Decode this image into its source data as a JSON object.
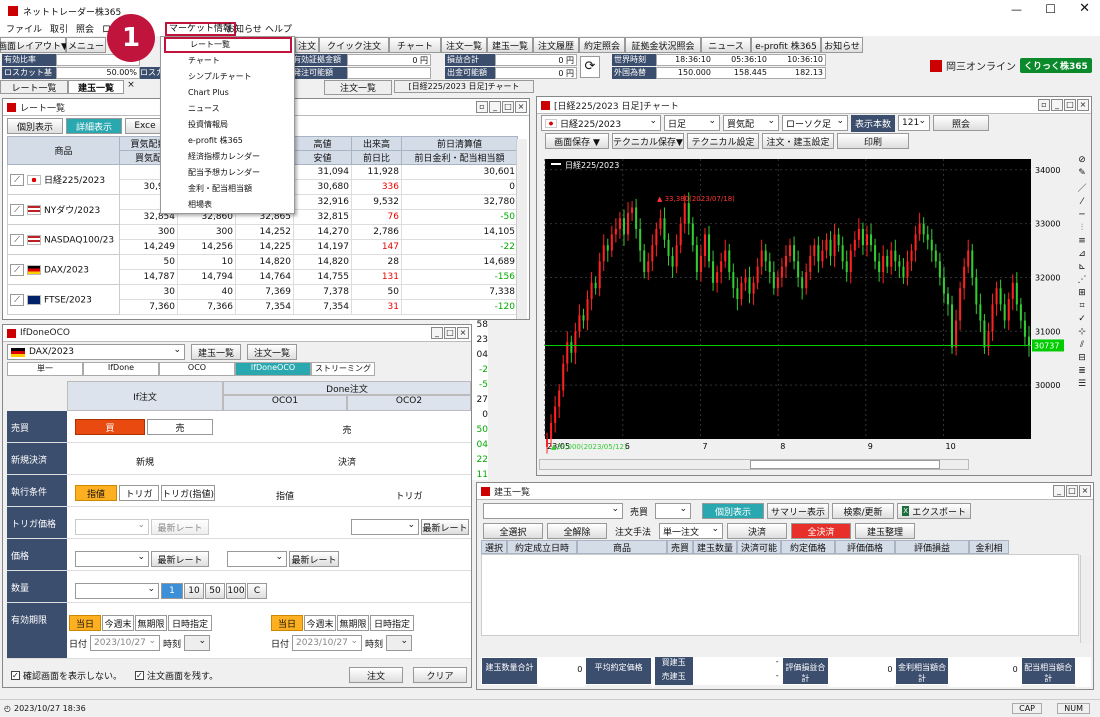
{
  "app": {
    "title": "ネットトレーダー株365"
  },
  "menubar": [
    "ファイル",
    "取引",
    "照会",
    "ロ"
  ],
  "menu_open": {
    "label": "マーケット情報",
    "other": [
      "お知らせ",
      "ヘルプ"
    ]
  },
  "dropdown": [
    "レート一覧",
    "チャート",
    "シンプルチャート",
    "Chart Plus",
    "ニュース",
    "投資情報局",
    "e-profit 株365",
    "経済指標カレンダー",
    "配当予想カレンダー",
    "金利・配当相当額",
    "相場表"
  ],
  "callout": "1",
  "toolbar1": [
    "画面レイアウト▼",
    "メニュー"
  ],
  "toolbar2": [
    "注文",
    "クイック注文",
    "チャート",
    "注文一覧",
    "建玉一覧",
    "注文履歴",
    "約定照会",
    "証拠金状況照会",
    "ニュース",
    "e-profit 株365",
    "お知らせ"
  ],
  "status_left": [
    [
      "有効比率",
      ""
    ],
    [
      "ロスカット基準",
      "50.00%"
    ]
  ],
  "status_left_labels": [
    "ロスカ"
  ],
  "status_mid": [
    [
      "有効証拠金額",
      "0 円"
    ],
    [
      "発注可能額",
      ""
    ]
  ],
  "status_mid2": [
    [
      "損益合計",
      "0 円"
    ],
    [
      "出金可能額",
      "0 円"
    ]
  ],
  "times": {
    "world": "世界時刻",
    "fx": "外国為替",
    "t1": "18:36:10",
    "t2": "05:36:10",
    "t3": "10:36:10",
    "r1": "150.000",
    "r2": "158.445",
    "r3": "182.13"
  },
  "brand": {
    "name": "岡三オンライン",
    "badge": "くりっく株365"
  },
  "tabs": [
    "レート一覧",
    "建玉一覧",
    "×",
    "注文一覧",
    "[日経225/2023 日足]チャート"
  ],
  "rate_window": {
    "title": "レート一覧",
    "btn1": "個別表示",
    "btn2": "詳細表示",
    "btn3": "Exce",
    "headers": [
      "商品",
      "買気配数",
      "",
      "高値",
      "出来高",
      "前日清算値"
    ],
    "subheaders": [
      "買気配",
      "",
      "",
      "安値",
      "前日比",
      "前日金利・配当相当額"
    ],
    "rows": [
      {
        "name": "日経225/2023",
        "flag": "jp",
        "a1": "",
        "a2": "",
        "a3": "",
        "hi": "31,094",
        "vol": "11,928",
        "prev": "30,601",
        "b1": "30,930",
        "b2": "",
        "b3": "",
        "lo": "30,680",
        "chg": "336",
        "cv": "red",
        "acc": "0"
      },
      {
        "name": "NYダウ/2023",
        "flag": "us",
        "a1": "3",
        "a2": "",
        "a3": "",
        "hi": "32,916",
        "vol": "9,532",
        "prev": "32,780",
        "b1": "32,854",
        "b2": "32,860",
        "b3": "32,865",
        "lo": "32,815",
        "chg": "76",
        "cv": "red",
        "acc": "-50"
      },
      {
        "name": "NASDAQ100/23",
        "flag": "us",
        "a1": "300",
        "a2": "300",
        "a3": "14,252",
        "hi": "14,270",
        "vol": "2,786",
        "prev": "14,105",
        "b1": "14,249",
        "b2": "14,256",
        "b3": "14,225",
        "lo": "14,197",
        "chg": "147",
        "cv": "red",
        "acc": "-22"
      },
      {
        "name": "DAX/2023",
        "flag": "de",
        "a1": "50",
        "a2": "10",
        "a3": "14,820",
        "hi": "14,820",
        "vol": "28",
        "prev": "14,689",
        "b1": "14,787",
        "b2": "14,794",
        "b3": "14,764",
        "lo": "14,755",
        "chg": "131",
        "cv": "red",
        "acc": "-156"
      },
      {
        "name": "FTSE/2023",
        "flag": "uk",
        "a1": "30",
        "a2": "40",
        "a3": "7,369",
        "hi": "7,378",
        "vol": "50",
        "prev": "7,338",
        "b1": "7,360",
        "b2": "7,366",
        "b3": "7,354",
        "lo": "7,354",
        "chg": "31",
        "cv": "red",
        "acc": "-120"
      }
    ],
    "extra": [
      "58",
      "23",
      "04",
      "-2",
      "-5",
      "27",
      "0",
      "50",
      "04",
      "22",
      "11"
    ]
  },
  "ifdone": {
    "title": "IfDoneOCO",
    "product": "DAX/2023",
    "btn1": "建玉一覧",
    "btn2": "注文一覧",
    "tabs": [
      "単一",
      "IfDone",
      "OCO",
      "IfDoneOCO",
      "ストリーミング"
    ],
    "head_if": "If注文",
    "head_done": "Done注文",
    "oco1": "OCO1",
    "oco2": "OCO2",
    "row_labels": [
      "売買",
      "新規決済",
      "執行条件",
      "トリガ価格",
      "価格",
      "数量",
      "有効期限"
    ],
    "buy": "買",
    "sell": "売",
    "sell2": "売",
    "new": "新規",
    "close": "決済",
    "cond": [
      "指値",
      "トリガ",
      "トリガ(指値)"
    ],
    "cond2": "指値",
    "cond3": "トリガ",
    "latest": "最新レート",
    "qty_btns": [
      "1",
      "10",
      "50",
      "100",
      "C"
    ],
    "exp": [
      "当日",
      "今週末",
      "無期限",
      "日時指定"
    ],
    "date_label": "日付",
    "date": "2023/10/27",
    "time_label": "時刻",
    "chk1": "確認画面を表示しない。",
    "chk2": "注文画面を残す。",
    "order": "注文",
    "clear": "クリア"
  },
  "chart_window": {
    "title": "[日経225/2023 日足]チャート",
    "product": "日経225/2023",
    "period": "日足",
    "price": "買気配",
    "style": "ローソク足",
    "count_label": "表示本数",
    "count": "121",
    "query": "照会",
    "btns": [
      "画面保存 ▼",
      "テクニカル保存▼",
      "テクニカル設定",
      "注文・建玉設定",
      "印刷"
    ],
    "legend": "日経225/2023",
    "high_note": "▲ 33,380(2023/07/18)",
    "low_note": "▲29,000(2023/05/12)",
    "last": "30737",
    "yticks": [
      "34000",
      "33000",
      "32000",
      "31000",
      "30000"
    ],
    "xticks": [
      "23/05",
      "6",
      "7",
      "8",
      "9",
      "10"
    ]
  },
  "positions": {
    "title": "建玉一覧",
    "side": "売買",
    "btns": [
      "個別表示",
      "サマリー表示",
      "検索/更新",
      "エクスポート"
    ],
    "btns2": [
      "全選択",
      "全解除"
    ],
    "method": "注文手法",
    "method_val": "単一注文",
    "settle": "決済",
    "allsettle": "全決済",
    "organize": "建玉整理",
    "cols": [
      "選択",
      "約定成立日時",
      "商品",
      "売買",
      "建玉数量",
      "決済可能",
      "約定価格",
      "評価価格",
      "評価損益",
      "金利相"
    ],
    "foot": [
      [
        "建玉数量合計",
        "0"
      ],
      [
        "平均約定価格",
        ""
      ],
      [
        "買建玉",
        "-"
      ],
      [
        "売建玉",
        "-"
      ],
      [
        "評価損益合計",
        "0"
      ],
      [
        "金利相当額合計",
        "0"
      ],
      [
        "配当相当額合計",
        ""
      ]
    ]
  },
  "statusbar": {
    "left": "2023/10/27 18:36",
    "cap": "CAP",
    "num": "NUM"
  },
  "chart_data": {
    "type": "candlestick",
    "title": "日経225/2023",
    "yrange": [
      29000,
      34200
    ],
    "x": [
      "23/05",
      "6",
      "7",
      "8",
      "9",
      "10"
    ],
    "values": [
      29000,
      29300,
      29600,
      29900,
      30400,
      30800,
      30600,
      31000,
      31300,
      31200,
      31600,
      31900,
      31800,
      32300,
      32600,
      32500,
      32800,
      32900,
      33100,
      32800,
      33200,
      33300,
      32900,
      32500,
      32100,
      32300,
      32600,
      32900,
      33100,
      32700,
      32400,
      32200,
      32600,
      33000,
      33380,
      33000,
      32600,
      32100,
      32400,
      32800,
      32300,
      31900,
      32100,
      32300,
      32500,
      32100,
      31800,
      31600,
      31900,
      32000,
      31700,
      31900,
      32200,
      32500,
      32300,
      32100,
      31800,
      32000,
      32200,
      32400,
      32600,
      32300,
      32000,
      31800,
      32100,
      32400,
      32600,
      32300,
      32500,
      32700,
      32400,
      32800,
      32600,
      32300,
      32100,
      32500,
      32700,
      32900,
      32600,
      32800,
      32600,
      32300,
      32100,
      32400,
      32200,
      32500,
      32300,
      32200,
      32000,
      32300,
      32500,
      32800,
      33000,
      32800,
      32700,
      32500,
      32300,
      32000,
      31700,
      31500,
      30700,
      31200,
      31800,
      32200,
      32500,
      32000,
      31500,
      31200,
      30700,
      31000,
      31500,
      31800,
      31500,
      31200,
      31600,
      31900,
      31500,
      31200,
      30900,
      30737
    ]
  }
}
